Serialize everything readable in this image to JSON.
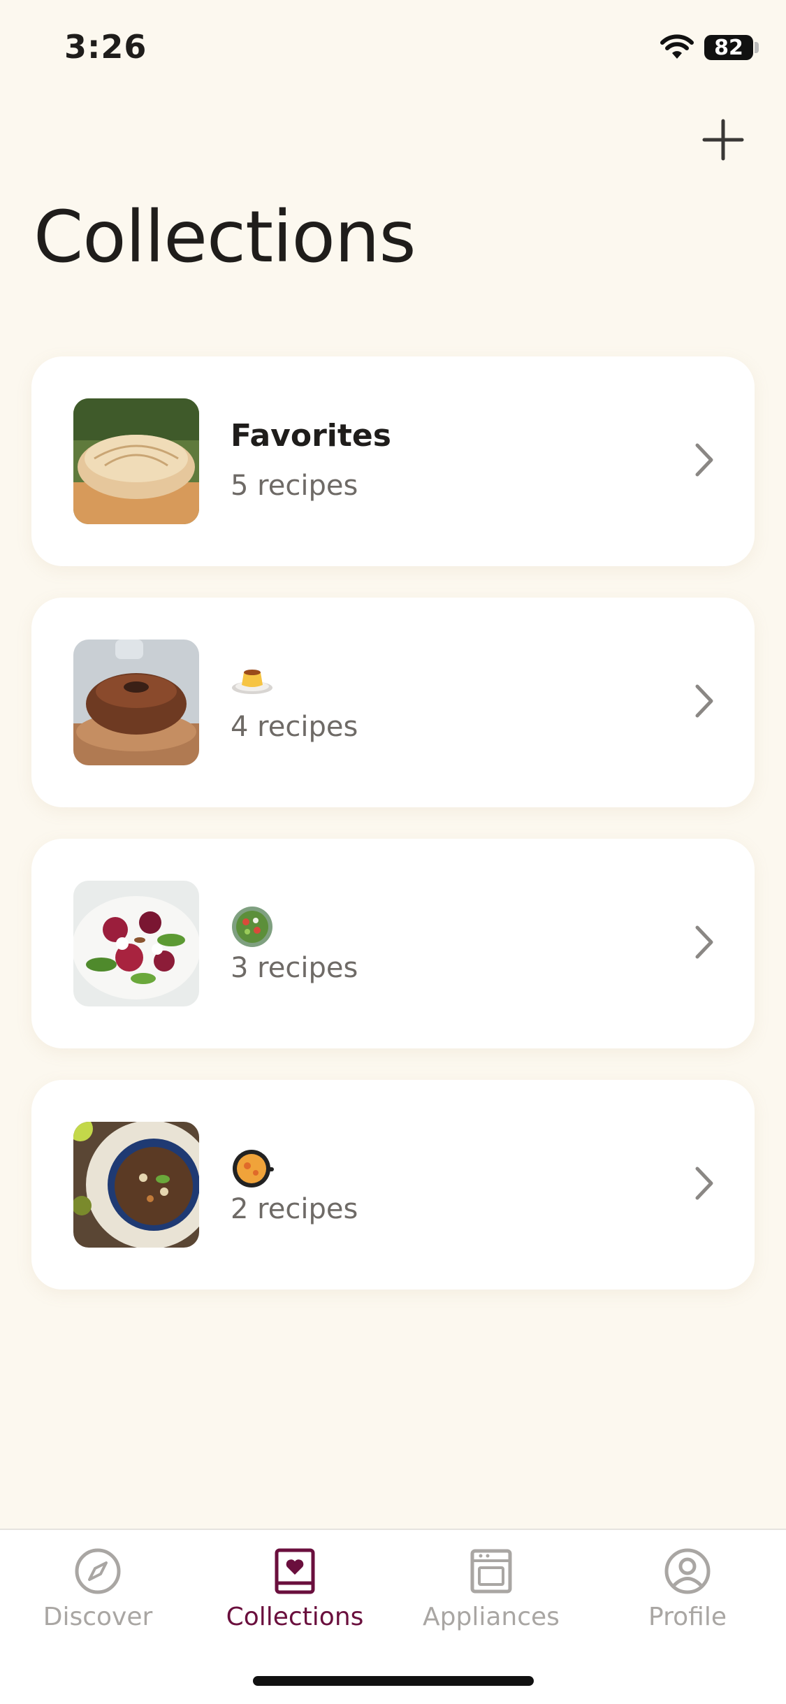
{
  "status_bar": {
    "time": "3:26",
    "battery": "82"
  },
  "header": {
    "title": "Collections"
  },
  "collections": [
    {
      "title": "Favorites",
      "count": "5 recipes"
    },
    {
      "emoji": "flan-icon",
      "count": "4 recipes"
    },
    {
      "emoji": "salad-icon",
      "count": "3 recipes"
    },
    {
      "emoji": "paella-pan-icon",
      "count": "2 recipes"
    }
  ],
  "tabs": [
    {
      "label": "Discover",
      "icon": "compass-icon"
    },
    {
      "label": "Collections",
      "icon": "book-heart-icon",
      "active": true
    },
    {
      "label": "Appliances",
      "icon": "oven-icon"
    },
    {
      "label": "Profile",
      "icon": "user-circle-icon"
    }
  ],
  "colors": {
    "background": "#fcf8ef",
    "accent": "#6a0f3d",
    "inactive": "#a9a6a3"
  }
}
